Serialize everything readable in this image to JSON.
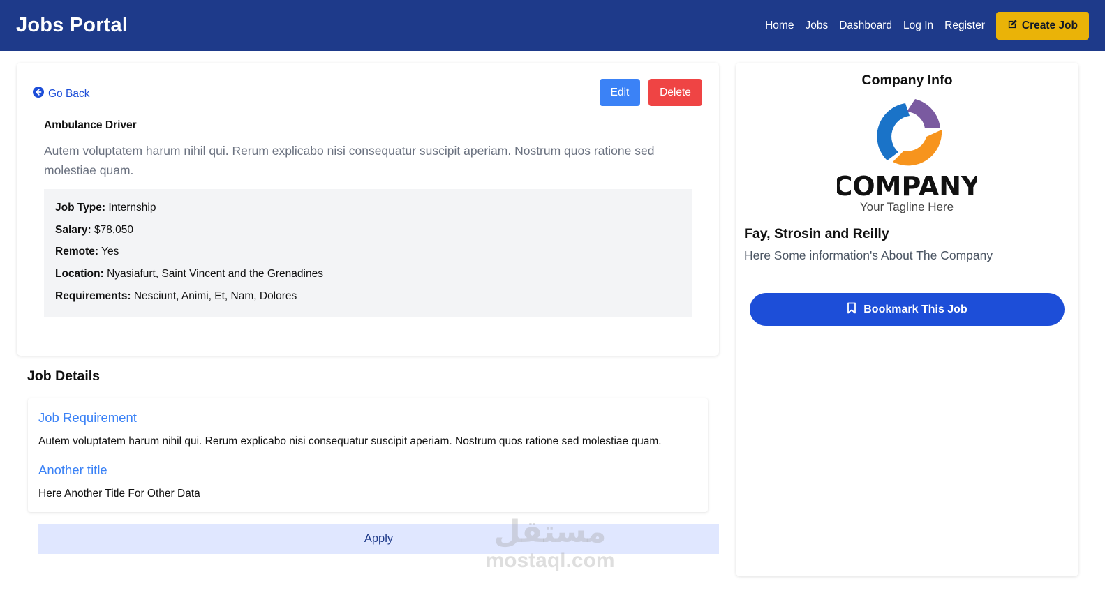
{
  "navbar": {
    "brand": "Jobs Portal",
    "links": [
      "Home",
      "Jobs",
      "Dashboard",
      "Log In",
      "Register"
    ],
    "create_label": "Create Job",
    "bg_color": "#1e3a8a",
    "accent_color": "#eab308"
  },
  "job": {
    "go_back": "Go Back",
    "edit_label": "Edit",
    "delete_label": "Delete",
    "title": "Ambulance Driver",
    "description": "Autem voluptatem harum nihil qui. Rerum explicabo nisi consequatur suscipit aperiam. Nostrum quos ratione sed molestiae quam.",
    "fields": [
      {
        "label": "Job Type:",
        "value": "Internship"
      },
      {
        "label": "Salary:",
        "value": "$78,050"
      },
      {
        "label": "Remote:",
        "value": "Yes"
      },
      {
        "label": "Location:",
        "value": "Nyasiafurt, Saint Vincent and the Grenadines"
      },
      {
        "label": "Requirements:",
        "value": "Nesciunt, Animi, Et, Nam, Dolores"
      }
    ]
  },
  "details": {
    "heading": "Job Details",
    "sections": [
      {
        "title": "Job Requirement",
        "text": "Autem voluptatem harum nihil qui. Rerum explicabo nisi consequatur suscipit aperiam. Nostrum quos ratione sed molestiae quam."
      },
      {
        "title": "Another title",
        "text": "Here Another Title For Other Data"
      }
    ],
    "apply_label": "Apply"
  },
  "company": {
    "heading": "Company Info",
    "logo_word": "COMPANY",
    "logo_tagline": "Your Tagline Here",
    "name": "Fay, Strosin and Reilly",
    "info": "Here Some information's About The Company",
    "bookmark_label": "Bookmark This Job"
  },
  "watermark": {
    "arabic": "مستقل",
    "latin": "mostaql.com"
  },
  "icons": {
    "go_back": "circle-arrow-left-icon",
    "create": "edit-square-icon",
    "bookmark": "bookmark-icon"
  }
}
